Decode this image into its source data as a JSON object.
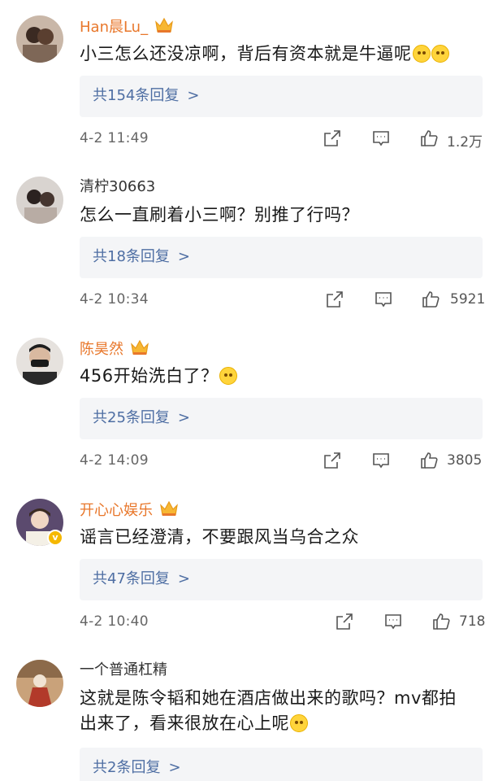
{
  "comments": [
    {
      "username": "Han晨Lu_",
      "vip": true,
      "text": "小三怎么还没凉啊，背后有资本就是牛逼呢",
      "emoji_count": 2,
      "reply_label": "共154条回复",
      "reply_chevron": ">",
      "time": "4-2 11:49",
      "likes": "1.2万",
      "icons": [
        "share-icon",
        "comment-icon",
        "like-icon"
      ]
    },
    {
      "username": "清柠30663",
      "vip": false,
      "text": "怎么一直刷着小三啊？别推了行吗？",
      "emoji_count": 0,
      "reply_label": "共18条回复",
      "reply_chevron": ">",
      "time": "4-2 10:34",
      "likes": "5921",
      "icons": [
        "share-icon",
        "comment-icon",
        "like-icon"
      ]
    },
    {
      "username": "陈昊然",
      "vip": true,
      "text": "456开始洗白了？",
      "emoji_count": 1,
      "reply_label": "共25条回复",
      "reply_chevron": ">",
      "time": "4-2 14:09",
      "likes": "3805",
      "icons": [
        "share-icon",
        "comment-icon",
        "like-icon"
      ]
    },
    {
      "username": "开心心娱乐",
      "vip": true,
      "verified": true,
      "text": "谣言已经澄清，不要跟风当乌合之众",
      "emoji_count": 0,
      "reply_label": "共47条回复",
      "reply_chevron": ">",
      "time": "4-2 10:40",
      "likes": "718",
      "icons": [
        "share-icon",
        "comment-icon",
        "like-icon"
      ]
    },
    {
      "username": "一个普通杠精",
      "vip": false,
      "text_line1": "这就是陈令韬和她在酒店做出来的歌吗？mv都拍",
      "text_line2": "出来了，看来很放在心上呢",
      "emoji_count": 1,
      "reply_label": "共2条回复",
      "reply_chevron": ">"
    }
  ],
  "colors": {
    "vip_name": "#e8772b",
    "reply_link": "#4e6ea3",
    "reply_bg": "#f4f5f7"
  }
}
